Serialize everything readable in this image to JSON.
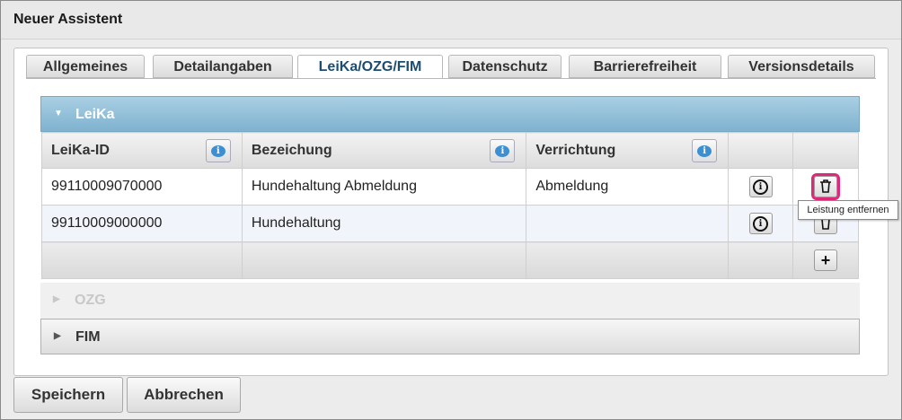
{
  "window": {
    "title": "Neuer Assistent"
  },
  "tabs": [
    {
      "label": "Allgemeines",
      "active": false
    },
    {
      "label": "Detailangaben",
      "active": false
    },
    {
      "label": "LeiKa/OZG/FIM",
      "active": true
    },
    {
      "label": "Datenschutz",
      "active": false
    },
    {
      "label": "Barrierefreiheit",
      "active": false
    },
    {
      "label": "Versionsdetails",
      "active": false
    }
  ],
  "leika": {
    "header": "LeiKa",
    "columns": [
      "LeiKa-ID",
      "Bezeichung",
      "Verrichtung"
    ],
    "rows": [
      {
        "id": "99110009070000",
        "bezeichnung": "Hundehaltung Abmeldung",
        "verrichtung": "Abmeldung"
      },
      {
        "id": "99110009000000",
        "bezeichnung": "Hundehaltung",
        "verrichtung": ""
      }
    ],
    "add_label": "+"
  },
  "ozg": {
    "header": "OZG"
  },
  "fim": {
    "header": "FIM"
  },
  "tooltip": "Leistung entfernen",
  "footer": {
    "save_label": "Speichern",
    "cancel_label": "Abbrechen"
  },
  "colors": {
    "accent_header": "#7fb2cf",
    "highlight": "#e0287a"
  }
}
